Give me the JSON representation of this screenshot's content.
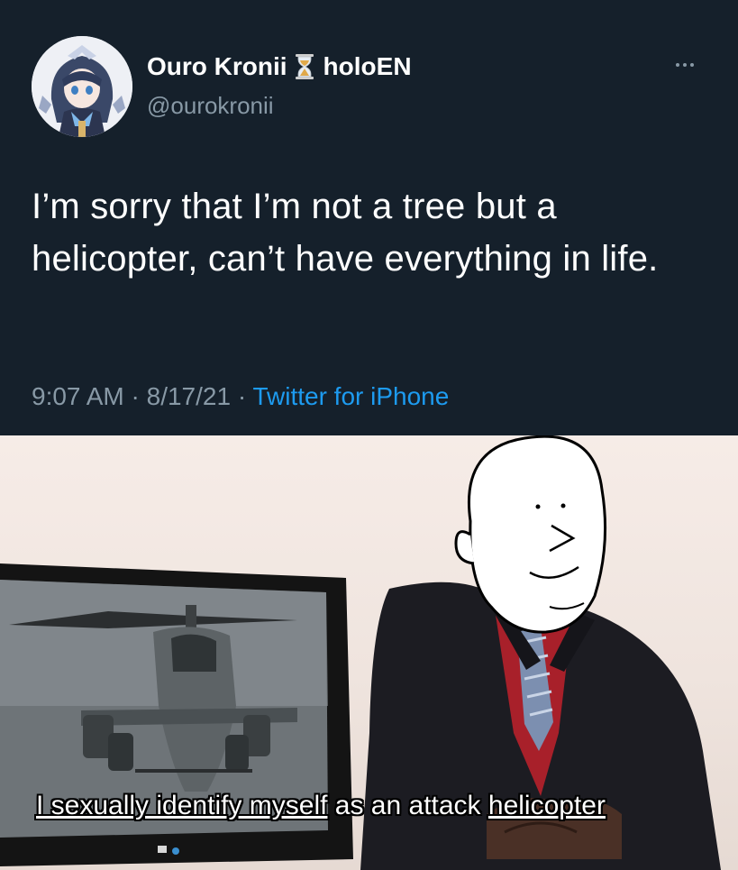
{
  "tweet": {
    "display_name": "Ouro Kronii",
    "name_emoji": "hourglass-icon",
    "display_name_suffix": "holoEN",
    "handle": "@ourokronii",
    "text": "I’m sorry that I’m not a tree but a helicopter, can’t have everything in life.",
    "time": "9:07 AM",
    "date": "8/17/21",
    "separator": "·",
    "source": "Twitter for iPhone",
    "more_icon": "more-options-icon",
    "colors": {
      "background": "#15202b",
      "text": "#ffffff",
      "muted": "#8899a6",
      "link": "#1d9bf0"
    }
  },
  "meme": {
    "caption_parts": [
      "I sexually identify myself",
      " as an attack ",
      "helicopter"
    ]
  }
}
